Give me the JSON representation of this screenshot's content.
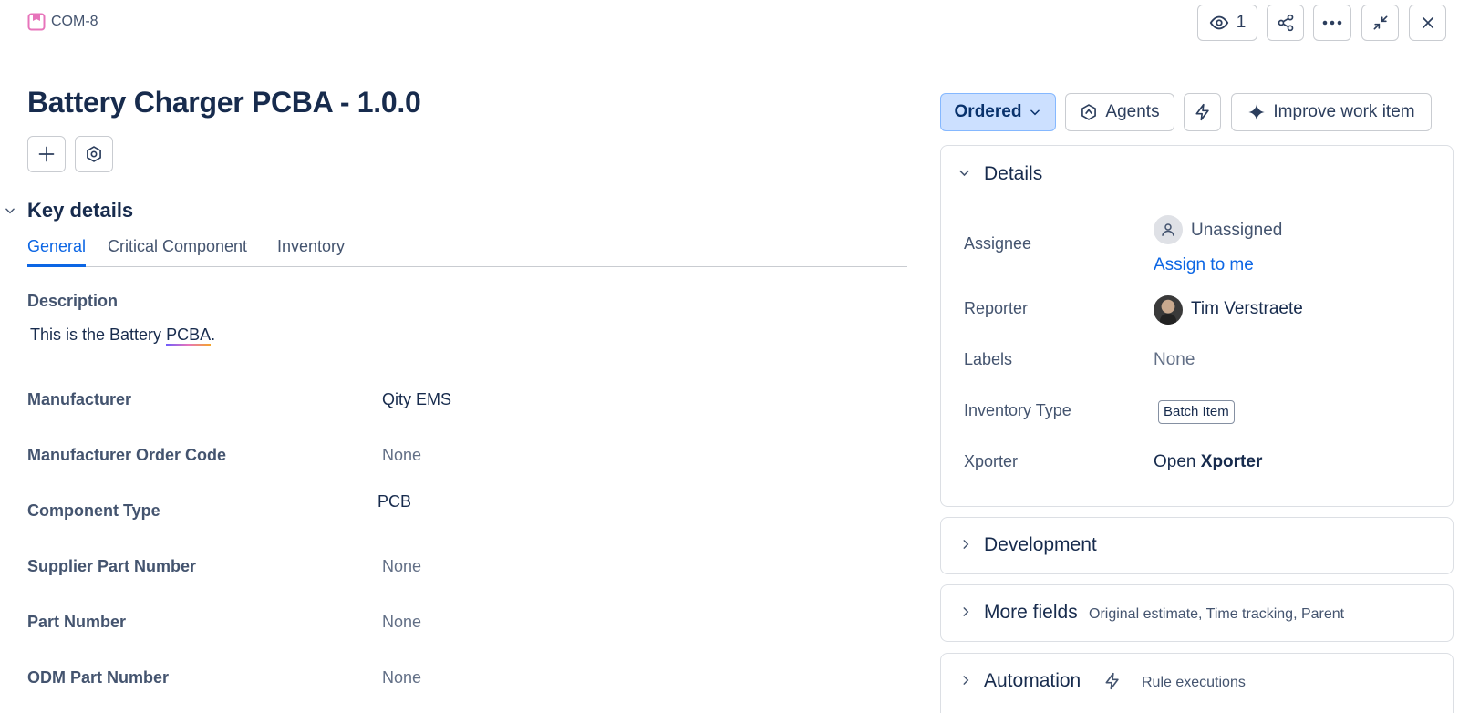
{
  "header": {
    "issue_key": "COM-8",
    "watch_count": "1"
  },
  "title": "Battery Charger PCBA - 1.0.0",
  "key_details": {
    "heading": "Key details",
    "tabs": [
      {
        "label": "General",
        "active": true
      },
      {
        "label": "Critical Component",
        "active": false
      },
      {
        "label": "Inventory",
        "active": false
      }
    ],
    "description_label": "Description",
    "description_prefix": "This is the Battery ",
    "description_highlight": "PCBA",
    "description_suffix": ".",
    "fields": [
      {
        "label": "Manufacturer",
        "value": "Qity EMS",
        "empty": false
      },
      {
        "label": "Manufacturer Order Code",
        "value": "None",
        "empty": true
      },
      {
        "label": "Component Type",
        "value": "PCB",
        "empty": false
      },
      {
        "label": "Supplier Part Number",
        "value": "None",
        "empty": true
      },
      {
        "label": "Part Number",
        "value": "None",
        "empty": true
      },
      {
        "label": "ODM Part Number",
        "value": "None",
        "empty": true
      }
    ]
  },
  "actions": {
    "status": "Ordered",
    "agents": "Agents",
    "improve": "Improve work item"
  },
  "details": {
    "title": "Details",
    "assignee_label": "Assignee",
    "assignee_value": "Unassigned",
    "assign_to_me": "Assign to me",
    "reporter_label": "Reporter",
    "reporter_value": "Tim Verstraete",
    "labels_label": "Labels",
    "labels_value": "None",
    "inventory_type_label": "Inventory Type",
    "inventory_type_value": "Batch Item",
    "xporter_label": "Xporter",
    "xporter_open": "Open",
    "xporter_name": "Xporter"
  },
  "development": {
    "title": "Development"
  },
  "more_fields": {
    "title": "More fields",
    "subtitle": "Original estimate, Time tracking, Parent"
  },
  "automation": {
    "title": "Automation",
    "subtitle": "Rule executions"
  },
  "colors": {
    "accent": "#0c66e4",
    "status_bg": "#cce0ff",
    "issue_icon": "#e774bb"
  }
}
